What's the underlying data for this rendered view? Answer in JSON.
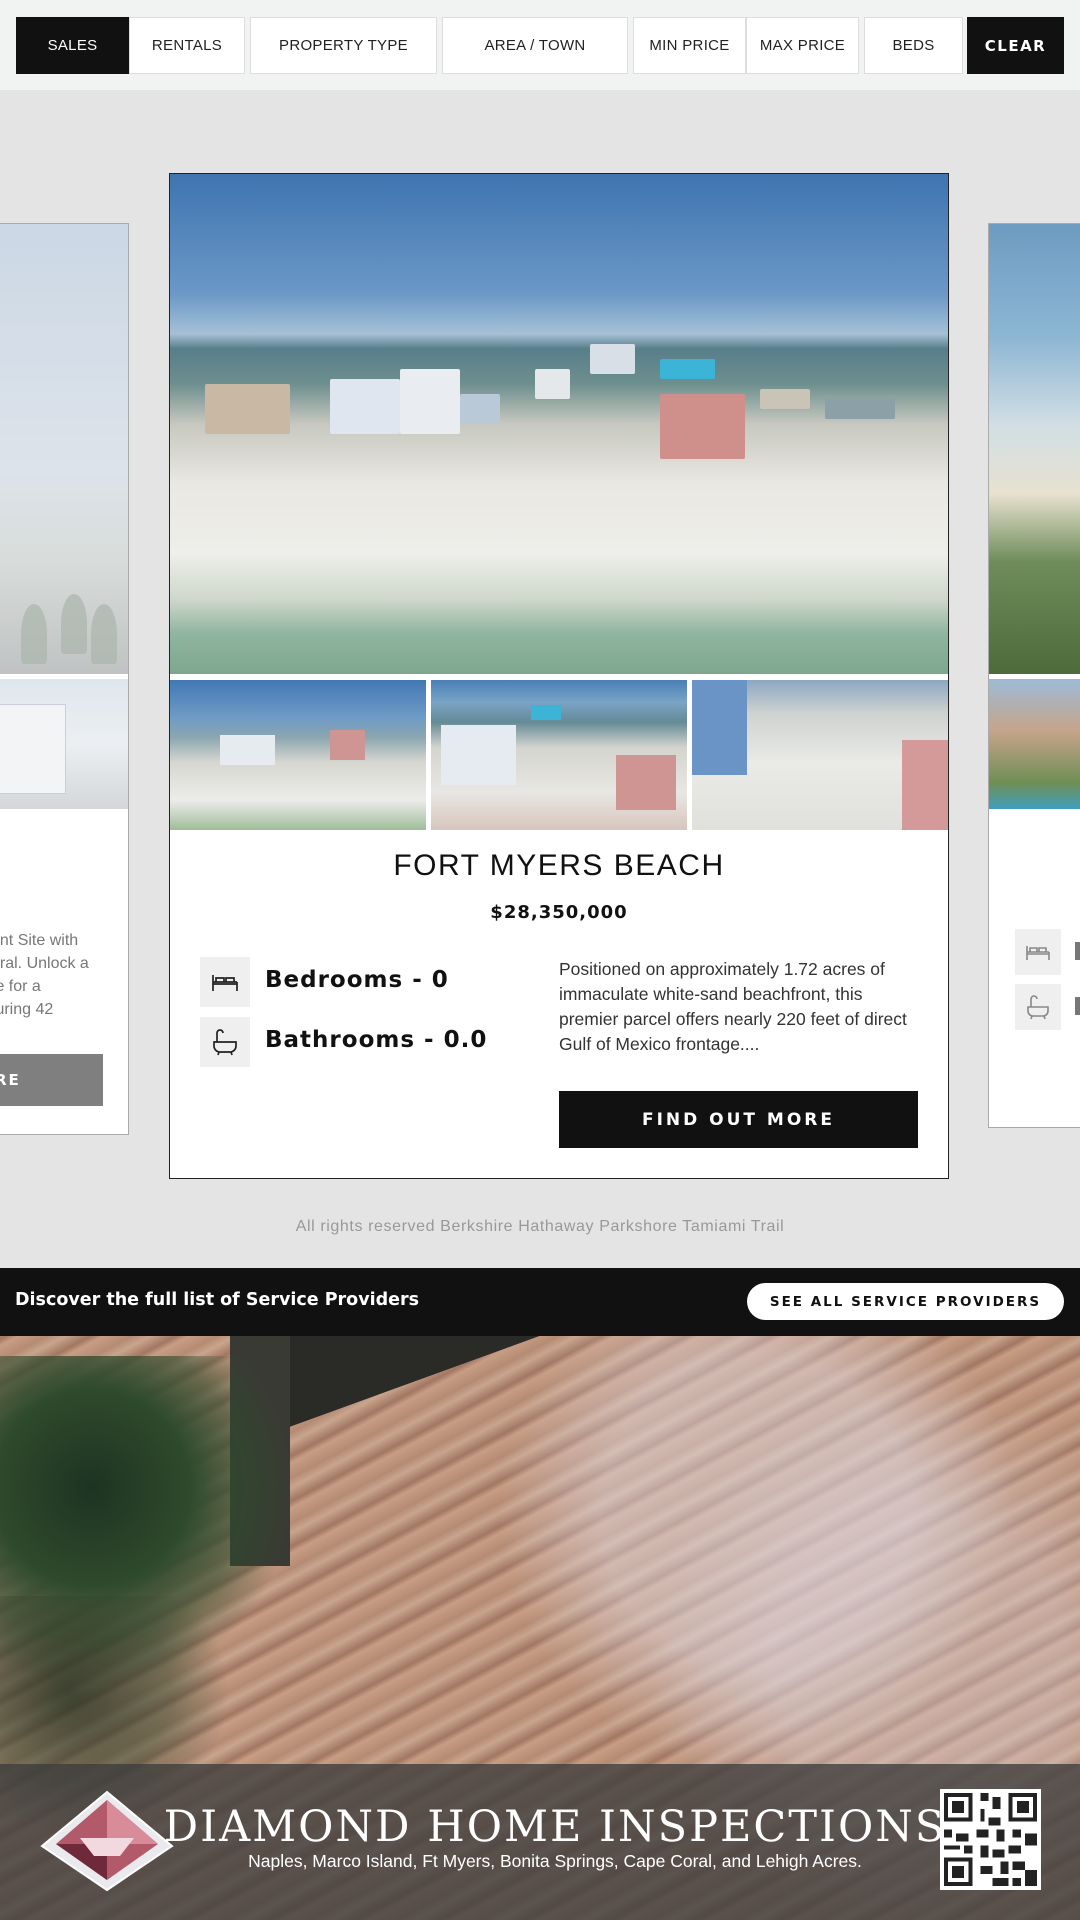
{
  "filters": {
    "sales": "SALES",
    "rentals": "RENTALS",
    "property_type": "PROPERTY TYPE",
    "area_town": "AREA / TOWN",
    "min_price": "MIN PRICE",
    "max_price": "MAX PRICE",
    "beds": "BEDS",
    "clear": "CLEAR"
  },
  "left_card": {
    "text_lines": [
      "ent Site with",
      "oral. Unlock a",
      "te for a",
      "turing 42"
    ],
    "button_label": "RE"
  },
  "listing": {
    "title": "FORT MYERS BEACH",
    "price": "$28,350,000",
    "bedrooms": "Bedrooms - 0",
    "bathrooms": "Bathrooms - 0.0",
    "description": "Positioned on approximately 1.72 acres of immaculate white-sand beachfront, this premier parcel offers nearly 220 feet of direct Gulf of Mexico frontage....",
    "button_label": "FIND OUT MORE"
  },
  "footer": {
    "rights": "All rights reserved Berkshire Hathaway Parkshore Tamiami Trail"
  },
  "service_bar": {
    "text": "Discover the full list of Service Providers",
    "button_label": "SEE ALL SERVICE PROVIDERS"
  },
  "ad": {
    "title": "DIAMOND HOME INSPECTIONS",
    "subtitle": "Naples, Marco Island, Ft Myers, Bonita Springs, Cape Coral, and Lehigh Acres."
  },
  "icons": {
    "bed": "bed-icon",
    "bath": "bathtub-icon",
    "logo": "diamond-logo-icon",
    "qr": "qr-code-icon"
  },
  "colors": {
    "primary": "#111111",
    "background": "#e4e4e4",
    "filter_bar": "#f1f3f3"
  }
}
